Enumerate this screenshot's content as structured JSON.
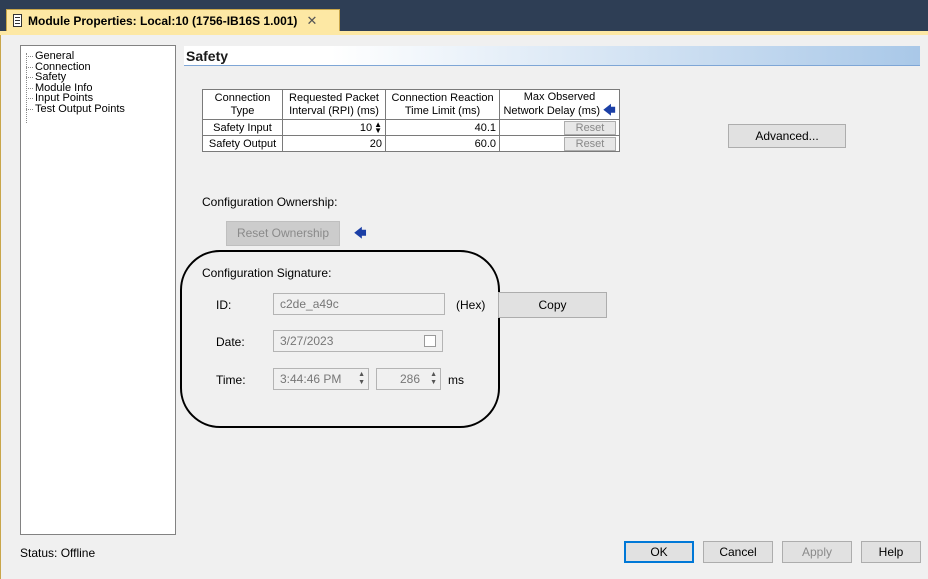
{
  "window": {
    "tab_title": "Module Properties: Local:10 (1756-IB16S 1.001)",
    "close_glyph": "✕"
  },
  "tree": {
    "items": [
      "General",
      "Connection",
      "Safety",
      "Module Info",
      "Input Points",
      "Test Output Points"
    ]
  },
  "section": {
    "title": "Safety"
  },
  "connection_table": {
    "headers": [
      [
        "Connection",
        "Type"
      ],
      [
        "Requested Packet",
        "Interval (RPI) (ms)"
      ],
      [
        "Connection Reaction",
        "Time Limit (ms)"
      ],
      [
        "Max Observed",
        "Network Delay (ms)"
      ]
    ],
    "rows": [
      {
        "type": "Safety Input",
        "rpi": "10",
        "limit": "40.1",
        "reset": "Reset"
      },
      {
        "type": "Safety Output",
        "rpi": "20",
        "limit": "60.0",
        "reset": "Reset"
      }
    ]
  },
  "advanced_button": "Advanced...",
  "ownership": {
    "label": "Configuration Ownership:",
    "reset_button": "Reset Ownership"
  },
  "signature": {
    "label": "Configuration Signature:",
    "id_label": "ID:",
    "id_value": "c2de_a49c",
    "hex_label": "(Hex)",
    "copy_button": "Copy",
    "date_label": "Date:",
    "date_value": "3/27/2023",
    "time_label": "Time:",
    "time_value": "3:44:46 PM",
    "ms_value": "286",
    "ms_label": "ms"
  },
  "status": {
    "text": "Status:  Offline"
  },
  "buttons": {
    "ok": "OK",
    "cancel": "Cancel",
    "apply": "Apply",
    "help": "Help"
  },
  "colors": {
    "title_bar": "#2e3e55",
    "tab_bg": "#fde8a4",
    "arrow": "#1b3fa6",
    "header_gradient": "#a9c8e8"
  }
}
